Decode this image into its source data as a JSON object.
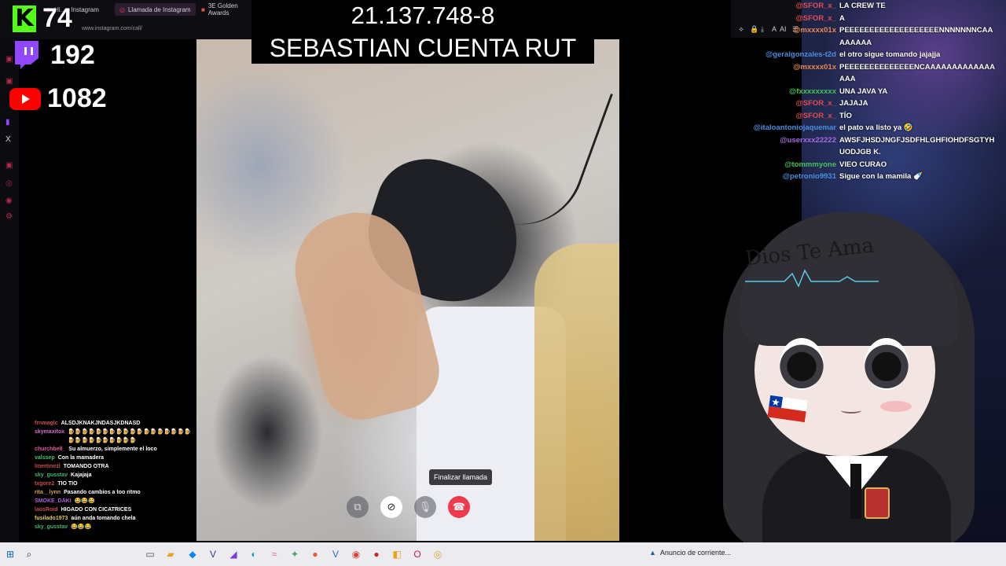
{
  "browser": {
    "tabs": [
      {
        "label": "Hi... - Instagram",
        "active": false
      },
      {
        "label": "Llamada de Instagram",
        "active": true
      },
      {
        "label": "3E Golden Awards",
        "active": false
      }
    ],
    "url": "www.instagram.com/call/",
    "toolbar_ai": "AI"
  },
  "stats": {
    "kick_viewers": "74",
    "twitch_viewers": "192",
    "youtube_viewers": "1082"
  },
  "overlay": {
    "rut": "21.137.748-8",
    "name": "SEBASTIAN CUENTA RUT"
  },
  "call": {
    "tooltip": "Finalizar llamada"
  },
  "left_chat": [
    {
      "user": "frnmaglc",
      "color": "#c94c4c",
      "msg": "ALSDJKNAKJNDASJKDNASD"
    },
    {
      "user": "skymaxitox",
      "color": "#d86ad0",
      "msg": "🍺🍺🍺🍺🍺🍺🍺🍺🍺🍺🍺🍺🍺🍺🍺🍺🍺🍺🍺🍺🍺🍺🍺🍺🍺🍺🍺🍺"
    },
    {
      "user": "churchbell_",
      "color": "#e0559f",
      "msg": "Su almuerzo, simplemente el loco"
    },
    {
      "user": "valssep",
      "color": "#4cc06a",
      "msg": "Con la mamadera"
    },
    {
      "user": "lmertinezl",
      "color": "#c94c4c",
      "msg": "TOMANDO OTRA"
    },
    {
      "user": "sky_gusstav",
      "color": "#47b56b",
      "msg": "Kajajaja"
    },
    {
      "user": "txgore2",
      "color": "#c94c4c",
      "msg": "TIO TIO"
    },
    {
      "user": "rita__lynn",
      "color": "#d6a04c",
      "msg": "Pasando cambios a too ritmo"
    },
    {
      "user": "SMOKE_DAKI",
      "color": "#b25ad9",
      "msg": "😂😂😂"
    },
    {
      "user": "laosRoid",
      "color": "#c94c4c",
      "msg": "HIGADO CON CICATRICES"
    },
    {
      "user": "fusilado1973",
      "color": "#e7c94c",
      "msg": "aún anda tomando chela"
    },
    {
      "user": "sky_gusstav",
      "color": "#47b56b",
      "msg": "😂😂😂"
    }
  ],
  "right_chat": [
    {
      "user": "@SFOR_x_",
      "color": "#e24b4b",
      "msg": "LA CREW TE"
    },
    {
      "user": "@SFOR_x_",
      "color": "#e24b4b",
      "msg": "A"
    },
    {
      "user": "@mxxxx01x",
      "color": "#e6884b",
      "msg": "PEEEEEEEEEEEEEEEEEEENNNNNNNCAAAAAAAA"
    },
    {
      "user": "@geralgonzales-t2d",
      "color": "#4a8fe0",
      "msg": "el otro sigue tomando jajajja"
    },
    {
      "user": "@mxxxx01x",
      "color": "#e6884b",
      "msg": "PEEEEEEEEEEEEEENCAAAAAAAAAAAAAAAA"
    },
    {
      "user": "@fxxxxxxxxx",
      "color": "#42c45a",
      "msg": "UNA JAVA YA"
    },
    {
      "user": "@SFOR_x_",
      "color": "#e24b4b",
      "msg": "JAJAJA"
    },
    {
      "user": "@SFOR_x_",
      "color": "#e24b4b",
      "msg": "TÍO"
    },
    {
      "user": "@italoantoniojaquemar",
      "color": "#4a8fe0",
      "msg": "el pato va listo ya 🤣"
    },
    {
      "user": "@userxxx22222",
      "color": "#a968e0",
      "msg": "AWSFJHSDJNGFJSDFHLGHFIOHDFSGTYHUODJGB K."
    },
    {
      "user": "@tommmyone",
      "color": "#42c45a",
      "msg": "VIEO CURAO"
    },
    {
      "user": "@petronio9931",
      "color": "#4a8fe0",
      "msg": "Sigue con la mamila 🍼"
    }
  ],
  "avatar": {
    "forehead_text": "Dios Te Ama"
  },
  "taskbar": {
    "notice": "Anuncio de corriente..."
  },
  "colors": {
    "kick": "#53fc18",
    "twitch": "#9146ff",
    "youtube": "#ff0000",
    "end_call": "#ee3a4a"
  }
}
